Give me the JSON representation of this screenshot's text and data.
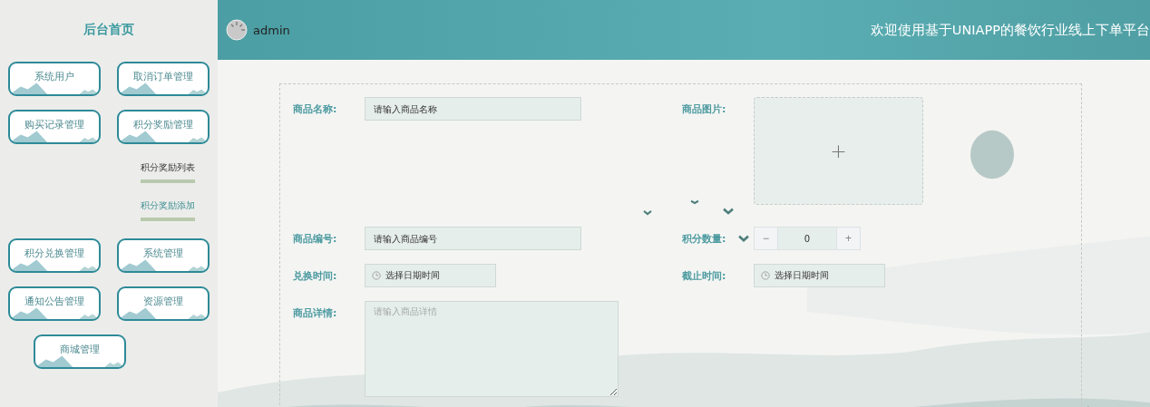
{
  "sidebar": {
    "title": "后台首页",
    "menu": [
      {
        "label": "系统用户"
      },
      {
        "label": "取消订单管理"
      },
      {
        "label": "购买记录管理"
      },
      {
        "label": "积分奖励管理",
        "children": [
          {
            "label": "积分奖励列表",
            "selected": false
          },
          {
            "label": "积分奖励添加",
            "selected": true
          }
        ]
      },
      {
        "label": "积分兑换管理"
      },
      {
        "label": "系统管理"
      },
      {
        "label": "通知公告管理"
      },
      {
        "label": "资源管理"
      },
      {
        "label": "商城管理"
      }
    ]
  },
  "header": {
    "username": "admin",
    "title": "欢迎使用基于UNIAPP的餐饮行业线上下单平台"
  },
  "form": {
    "fields": [
      {
        "kind": "text",
        "label": "商品名称:",
        "placeholder": "请输入商品名称"
      },
      {
        "kind": "upload",
        "label": "商品图片:",
        "icon": "+"
      },
      {
        "kind": "text",
        "label": "商品编号:",
        "placeholder": "请输入商品编号"
      },
      {
        "kind": "number",
        "label": "积分数量:",
        "value": "0",
        "minus": "−",
        "plus": "+"
      },
      {
        "kind": "datetime",
        "label": "兑换时间:",
        "placeholder": "选择日期时间"
      },
      {
        "kind": "datetime",
        "label": "截止时间:",
        "placeholder": "选择日期时间"
      },
      {
        "kind": "textarea",
        "label": "商品详情:",
        "placeholder": "请输入商品详情"
      }
    ]
  }
}
